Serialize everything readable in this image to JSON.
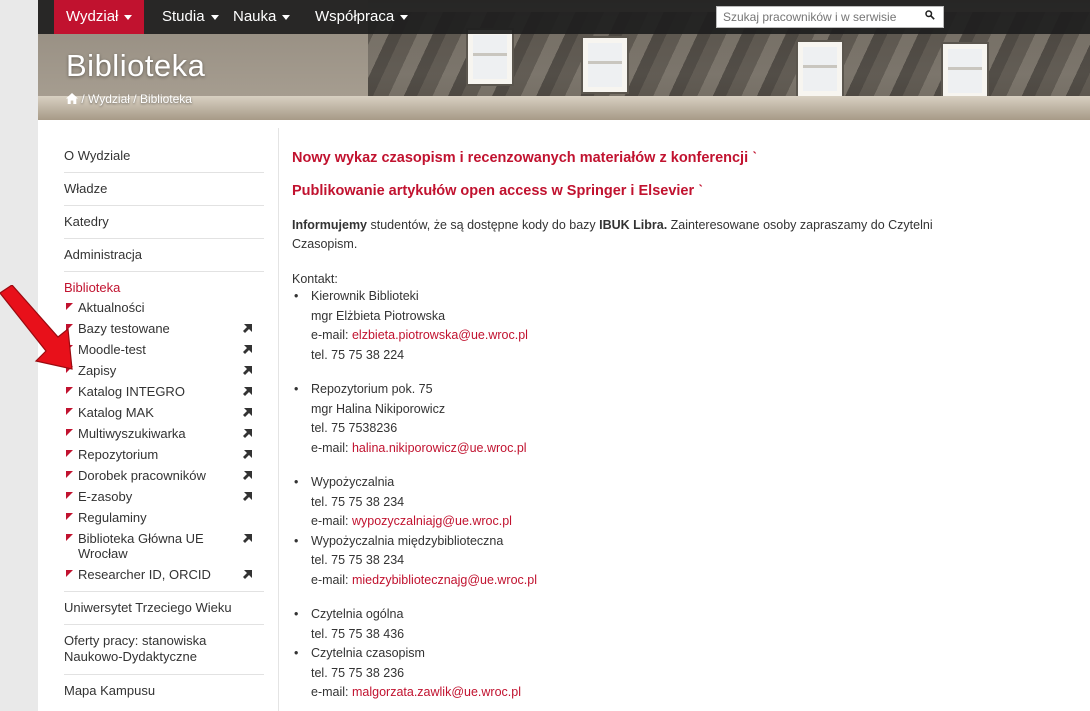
{
  "nav": {
    "items": [
      {
        "label": "Wydział"
      },
      {
        "label": "Studia"
      },
      {
        "label": "Nauka"
      },
      {
        "label": "Współpraca"
      }
    ],
    "search_placeholder": "Szukaj pracowników i w serwisie"
  },
  "header": {
    "title": "Biblioteka",
    "breadcrumb": [
      "Wydział",
      "Biblioteka"
    ]
  },
  "sidebar": {
    "items_before": [
      "O Wydziale",
      "Władze",
      "Katedry",
      "Administracja"
    ],
    "active": "Biblioteka",
    "sub": [
      {
        "label": "Aktualności",
        "ext": false
      },
      {
        "label": "Bazy testowane",
        "ext": true
      },
      {
        "label": "Moodle-test",
        "ext": true
      },
      {
        "label": "Zapisy",
        "ext": true
      },
      {
        "label": "Katalog INTEGRO",
        "ext": true
      },
      {
        "label": "Katalog MAK",
        "ext": true
      },
      {
        "label": "Multiwyszukiwarka",
        "ext": true
      },
      {
        "label": "Repozytorium",
        "ext": true
      },
      {
        "label": "Dorobek pracowników",
        "ext": true
      },
      {
        "label": "E-zasoby",
        "ext": true
      },
      {
        "label": "Regulaminy",
        "ext": false
      },
      {
        "label": "Biblioteka Główna UE Wrocław",
        "ext": true
      },
      {
        "label": "Researcher ID, ORCID",
        "ext": true
      }
    ],
    "items_after": [
      "Uniwersytet Trzeciego Wieku",
      "Oferty pracy: stanowiska Naukowo-Dydaktyczne",
      "Mapa Kampusu"
    ]
  },
  "content": {
    "headline1": "Nowy wykaz czasopism i  recenzowanych materiałów z konferencji",
    "headline2": "Publikowanie artykułów open access w Springer i Elsevier",
    "info_bold": "Informujemy",
    "info_text1": " studentów, że są dostępne kody do bazy ",
    "info_bold2": "IBUK Libra.",
    "info_text2": " Zainteresowane osoby zapraszamy do Czytelni Czasopism.",
    "contact_label": "Kontakt:",
    "contacts": [
      {
        "lines": [
          "Kierownik Biblioteki",
          "mgr Elżbieta Piotrowska"
        ],
        "email_prefix": "e-mail: ",
        "email": "elzbieta.piotrowska@ue.wroc.pl",
        "after": [
          "tel. 75 75 38 224"
        ]
      },
      {
        "lines": [
          "Repozytorium  pok. 75",
          "mgr Halina Nikiporowicz",
          "tel. 75 7538236"
        ],
        "email_prefix": "e-mail: ",
        "email": "halina.nikiporowicz@ue.wroc.pl",
        "after": []
      },
      {
        "lines": [
          "Wypożyczalnia",
          "tel. 75 75 38 234"
        ],
        "email_prefix": "e-mail: ",
        "email": "wypozyczalniajg@ue.wroc.pl",
        "after": []
      },
      {
        "lines": [
          "Wypożyczalnia międzybiblioteczna",
          "tel. 75 75 38 234"
        ],
        "email_prefix": "e-mail: ",
        "email": "miedzybibliotecznajg@ue.wroc.pl",
        "after": []
      },
      {
        "lines": [
          "Czytelnia ogólna",
          "tel. 75 75 38 436"
        ],
        "email_prefix": "",
        "email": "",
        "after": []
      },
      {
        "lines": [
          "Czytelnia czasopism",
          "tel. 75 75 38 236"
        ],
        "email_prefix": "e-mail: ",
        "email": "malgorzata.zawlik@ue.wroc.pl",
        "after": []
      }
    ]
  },
  "colors": {
    "accent": "#c1122f",
    "nav_bg": "#1e1e1e",
    "arrow": "#e8101a"
  }
}
